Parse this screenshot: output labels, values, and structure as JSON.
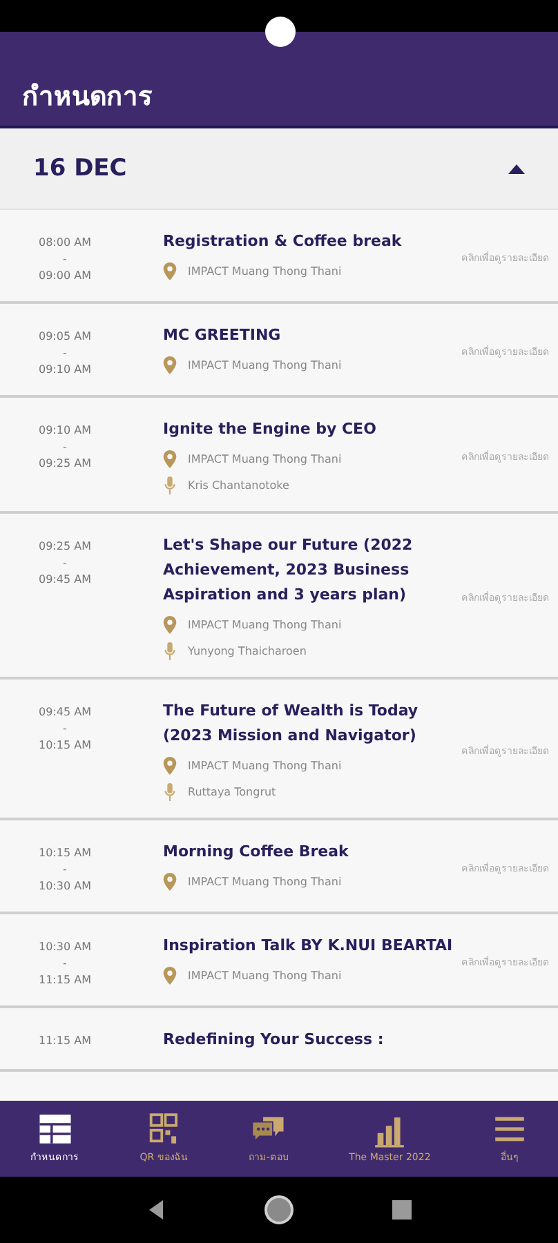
{
  "app_bar": {
    "title": "กำหนดการ"
  },
  "day": {
    "label": "16 DEC",
    "expanded": true
  },
  "sessions": [
    {
      "start": "08:00 AM",
      "sep": "-",
      "end": "09:00 AM",
      "title": "Registration & Coffee break",
      "location": "IMPACT Muang Thong Thani",
      "link": "คลิกเพื่อดูรายละเอียด"
    },
    {
      "start": "09:05 AM",
      "sep": "-",
      "end": "09:10 AM",
      "title": "MC GREETING",
      "location": "IMPACT Muang Thong Thani",
      "link": "คลิกเพื่อดูรายละเอียด"
    },
    {
      "start": "09:10 AM",
      "sep": "-",
      "end": "09:25 AM",
      "title": "Ignite the Engine by CEO",
      "location": "IMPACT Muang Thong Thani",
      "speaker": "Kris Chantanotoke",
      "link": "คลิกเพื่อดูรายละเอียด"
    },
    {
      "start": "09:25 AM",
      "sep": "-",
      "end": "09:45 AM",
      "title": "Let's Shape our Future (2022 Achievement, 2023 Business Aspiration and 3 years plan)",
      "location": "IMPACT Muang Thong Thani",
      "speaker": "Yunyong Thaicharoen",
      "link": "คลิกเพื่อดูรายละเอียด"
    },
    {
      "start": "09:45 AM",
      "sep": "-",
      "end": "10:15 AM",
      "title": "The Future of Wealth is Today (2023 Mission and Navigator)",
      "location": "IMPACT Muang Thong Thani",
      "speaker": "Ruttaya Tongrut",
      "link": "คลิกเพื่อดูรายละเอียด"
    },
    {
      "start": "10:15 AM",
      "sep": "-",
      "end": "10:30 AM",
      "title": "Morning Coffee Break",
      "location": "IMPACT Muang Thong Thani",
      "link": "คลิกเพื่อดูรายละเอียด"
    },
    {
      "start": "10:30 AM",
      "sep": "-",
      "end": "11:15 AM",
      "title": "Inspiration Talk BY K.NUI BEARTAI",
      "location": "IMPACT Muang Thong Thani",
      "link": "คลิกเพื่อดูรายละเอียด"
    },
    {
      "start": "11:15 AM",
      "title": "Redefining Your Success :"
    }
  ],
  "nav": [
    {
      "label": "กำหนดการ",
      "kind": "table",
      "selected": true
    },
    {
      "label": "QR ของฉัน",
      "kind": "qr",
      "selected": false
    },
    {
      "label": "ถาม-ตอบ",
      "kind": "chat",
      "selected": false
    },
    {
      "label": "The Master 2022",
      "kind": "bars",
      "selected": false
    },
    {
      "label": "อื่นๆ",
      "kind": "menu",
      "selected": false
    }
  ]
}
